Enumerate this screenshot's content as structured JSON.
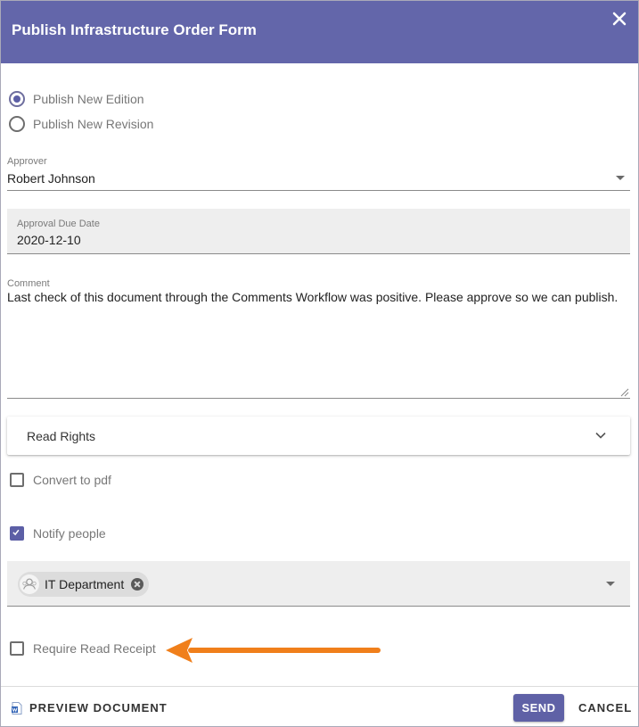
{
  "dialog": {
    "title": "Publish Infrastructure Order Form",
    "header_color": "#6366aa"
  },
  "publish_options": [
    {
      "label": "Publish New Edition",
      "selected": true
    },
    {
      "label": "Publish New Revision",
      "selected": false
    }
  ],
  "approver": {
    "label": "Approver",
    "value": "Robert Johnson"
  },
  "due_date": {
    "label": "Approval Due Date",
    "value": "2020-12-10"
  },
  "comment": {
    "label": "Comment",
    "value": "Last check of this document through the Comments Workflow was positive. Please approve so we can publish."
  },
  "read_rights": {
    "label": "Read Rights"
  },
  "checkboxes": {
    "convert_pdf": {
      "label": "Convert to pdf",
      "checked": false
    },
    "notify_people": {
      "label": "Notify people",
      "checked": true
    },
    "read_receipt": {
      "label": "Require Read Receipt",
      "checked": false
    }
  },
  "notify_recipients": [
    {
      "label": "IT Department",
      "icon": "group-icon"
    }
  ],
  "footer": {
    "preview_label": "PREVIEW DOCUMENT",
    "send_label": "SEND",
    "cancel_label": "CANCEL"
  },
  "annotation": {
    "arrow_color": "#f07f1b",
    "points_to": "read-receipt-checkbox"
  },
  "colors": {
    "accent": "#5c5fa6"
  }
}
